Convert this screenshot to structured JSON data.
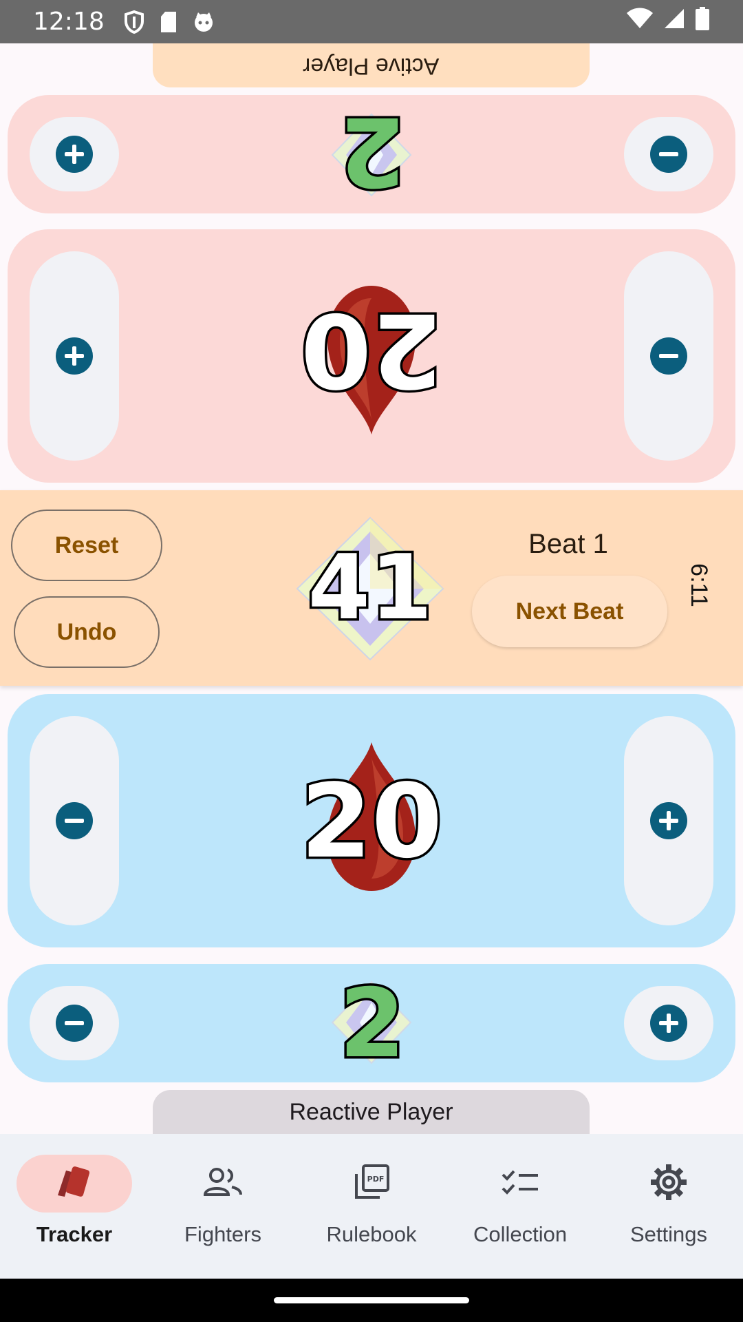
{
  "status_bar": {
    "time": "12:18",
    "icons_left": [
      "shield-icon",
      "sd-card-icon",
      "cat-icon"
    ],
    "icons_right": [
      "wifi-icon",
      "signal-icon",
      "battery-icon"
    ]
  },
  "top_player": {
    "label": "Active Player",
    "force": 2,
    "life": 20
  },
  "center": {
    "reset_label": "Reset",
    "undo_label": "Undo",
    "pool": 41,
    "beat_label": "Beat 1",
    "next_beat_label": "Next Beat",
    "timer": "6:11"
  },
  "bottom_player": {
    "label": "Reactive Player",
    "force": 2,
    "life": 20
  },
  "nav": {
    "items": [
      {
        "label": "Tracker",
        "icon": "cards-icon",
        "active": true
      },
      {
        "label": "Fighters",
        "icon": "people-icon",
        "active": false
      },
      {
        "label": "Rulebook",
        "icon": "pdf-icon",
        "active": false
      },
      {
        "label": "Collection",
        "icon": "checklist-icon",
        "active": false
      },
      {
        "label": "Settings",
        "icon": "gear-icon",
        "active": false
      }
    ]
  },
  "colors": {
    "top_panel": "#fcd9d7",
    "bottom_panel": "#bde6fb",
    "center_band": "#ffdcbb",
    "accent_icon": "#0b5e7d"
  }
}
